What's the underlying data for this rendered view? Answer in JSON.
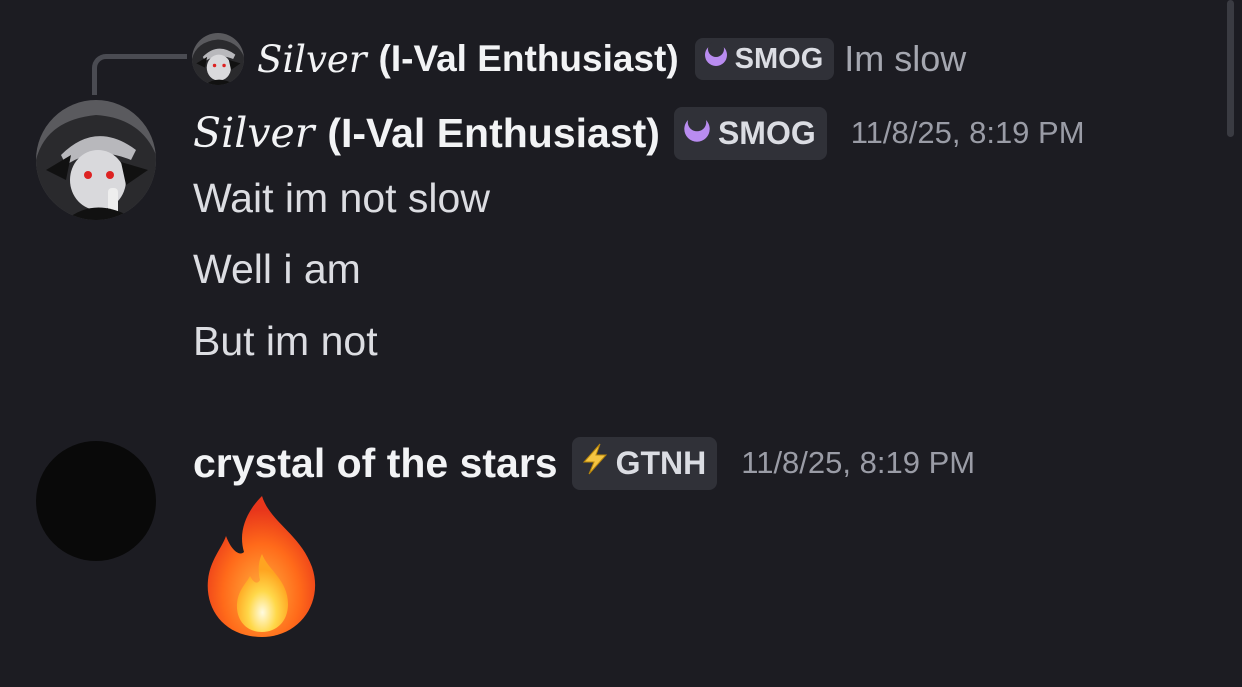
{
  "reply_preview": {
    "author_fancy": "Silver",
    "author_suffix": "(I-Val Enthusiast)",
    "tag": "SMOG",
    "text": "Im slow"
  },
  "messages": [
    {
      "author_fancy": "Silver",
      "author_suffix": "(I-Val Enthusiast)",
      "tag": "SMOG",
      "tag_icon": "crescent-icon",
      "timestamp": "11/8/25, 8:19 PM",
      "lines": [
        "Wait im not slow",
        "Well i am",
        "But im not"
      ]
    },
    {
      "author": "crystal of the stars",
      "tag": "GTNH",
      "tag_icon": "lightning-icon",
      "timestamp": "11/8/25, 8:19 PM",
      "emoji": "fire-emoji"
    }
  ],
  "colors": {
    "background": "#1c1c22",
    "tag_bg": "#303138",
    "smog_icon": "#b98cf0",
    "gtnh_icon": "#f5c542"
  }
}
